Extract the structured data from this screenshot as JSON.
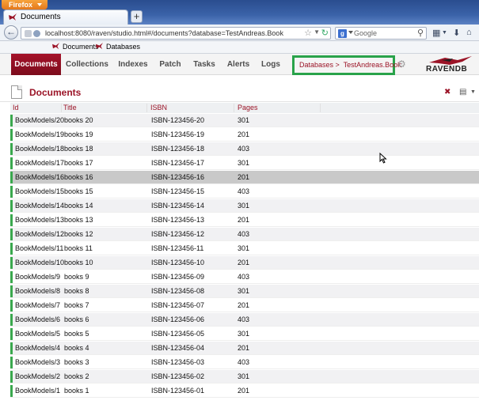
{
  "browser": {
    "menu_label": "Firefox",
    "tab_title": "Documents",
    "new_tab_label": "+",
    "url": "localhost:8080/raven/studio.html#/documents?database=TestAndreas.Book",
    "search_engine": "Google",
    "search_placeholder": "Google",
    "bookmarks": [
      "Documents",
      "Databases"
    ]
  },
  "app": {
    "nav": [
      "Documents",
      "Collections",
      "Indexes",
      "Patch",
      "Tasks",
      "Alerts",
      "Logs"
    ],
    "active_nav": "Documents",
    "breadcrumb_root": "Databases >",
    "breadcrumb_db": "TestAndreas.Book",
    "logo": "RAVENDB",
    "accent_color": "#9b1427",
    "highlight_color": "#29a34a"
  },
  "documents": {
    "title": "Documents",
    "columns": [
      "Id",
      "Title",
      "ISBN",
      "Pages"
    ],
    "rows": [
      {
        "id": "BookModels/20",
        "title": "books 20",
        "isbn": "ISBN-123456-20",
        "pages": "301"
      },
      {
        "id": "BookModels/19",
        "title": "books 19",
        "isbn": "ISBN-123456-19",
        "pages": "201"
      },
      {
        "id": "BookModels/18",
        "title": "books 18",
        "isbn": "ISBN-123456-18",
        "pages": "403"
      },
      {
        "id": "BookModels/17",
        "title": "books 17",
        "isbn": "ISBN-123456-17",
        "pages": "301"
      },
      {
        "id": "BookModels/16",
        "title": "books 16",
        "isbn": "ISBN-123456-16",
        "pages": "201"
      },
      {
        "id": "BookModels/15",
        "title": "books 15",
        "isbn": "ISBN-123456-15",
        "pages": "403"
      },
      {
        "id": "BookModels/14",
        "title": "books 14",
        "isbn": "ISBN-123456-14",
        "pages": "301"
      },
      {
        "id": "BookModels/13",
        "title": "books 13",
        "isbn": "ISBN-123456-13",
        "pages": "201"
      },
      {
        "id": "BookModels/12",
        "title": "books 12",
        "isbn": "ISBN-123456-12",
        "pages": "403"
      },
      {
        "id": "BookModels/11",
        "title": "books 11",
        "isbn": "ISBN-123456-11",
        "pages": "301"
      },
      {
        "id": "BookModels/10",
        "title": "books 10",
        "isbn": "ISBN-123456-10",
        "pages": "201"
      },
      {
        "id": "BookModels/9",
        "title": "books 9",
        "isbn": "ISBN-123456-09",
        "pages": "403"
      },
      {
        "id": "BookModels/8",
        "title": "books 8",
        "isbn": "ISBN-123456-08",
        "pages": "301"
      },
      {
        "id": "BookModels/7",
        "title": "books 7",
        "isbn": "ISBN-123456-07",
        "pages": "201"
      },
      {
        "id": "BookModels/6",
        "title": "books 6",
        "isbn": "ISBN-123456-06",
        "pages": "403"
      },
      {
        "id": "BookModels/5",
        "title": "books 5",
        "isbn": "ISBN-123456-05",
        "pages": "301"
      },
      {
        "id": "BookModels/4",
        "title": "books 4",
        "isbn": "ISBN-123456-04",
        "pages": "201"
      },
      {
        "id": "BookModels/3",
        "title": "books 3",
        "isbn": "ISBN-123456-03",
        "pages": "403"
      },
      {
        "id": "BookModels/2",
        "title": "books 2",
        "isbn": "ISBN-123456-02",
        "pages": "301"
      },
      {
        "id": "BookModels/1",
        "title": "books 1",
        "isbn": "ISBN-123456-01",
        "pages": "201"
      }
    ],
    "selected_row": "BookModels/16"
  }
}
